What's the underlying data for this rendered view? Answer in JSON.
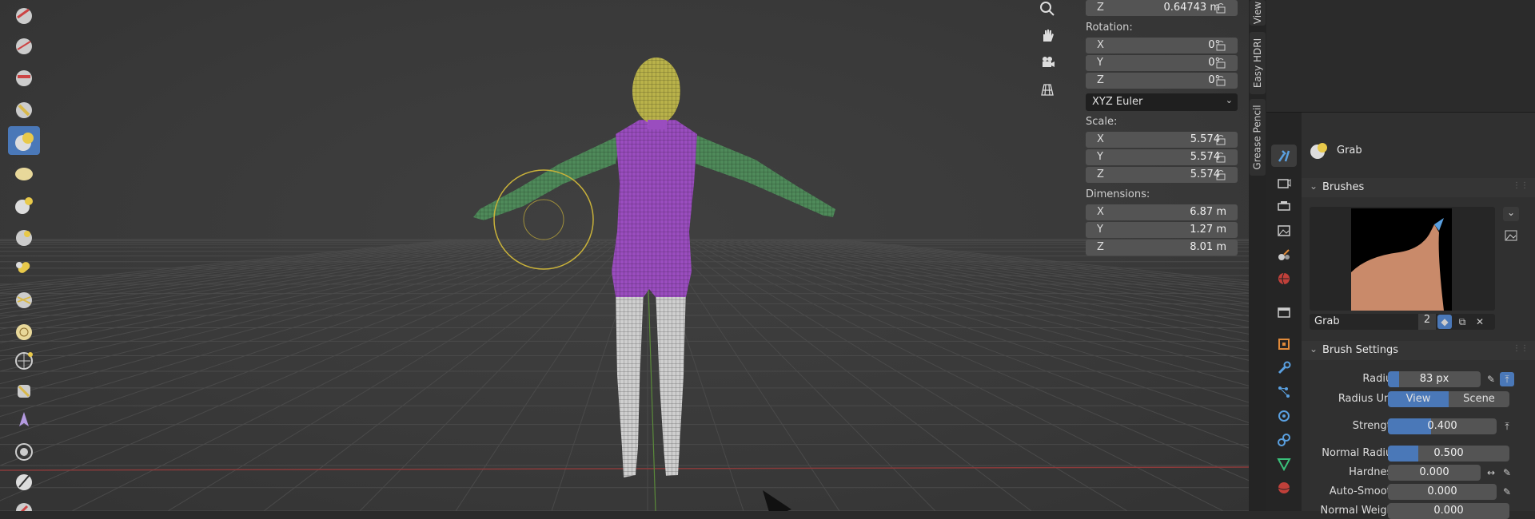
{
  "transform": {
    "location_z": {
      "axis": "Z",
      "value": "0.64743 m"
    },
    "rotation_label": "Rotation:",
    "rotation": [
      {
        "axis": "X",
        "value": "0°"
      },
      {
        "axis": "Y",
        "value": "0°"
      },
      {
        "axis": "Z",
        "value": "0°"
      }
    ],
    "rotation_mode": "XYZ Euler",
    "scale_label": "Scale:",
    "scale": [
      {
        "axis": "X",
        "value": "5.574"
      },
      {
        "axis": "Y",
        "value": "5.574"
      },
      {
        "axis": "Z",
        "value": "5.574"
      }
    ],
    "dimensions_label": "Dimensions:",
    "dimensions": [
      {
        "axis": "X",
        "value": "6.87 m"
      },
      {
        "axis": "Y",
        "value": "1.27 m"
      },
      {
        "axis": "Z",
        "value": "8.01 m"
      }
    ]
  },
  "side_tabs": [
    "View",
    "Easy HDRI",
    "Grease Pencil"
  ],
  "properties": {
    "tool_name": "Grab",
    "brushes_header": "Brushes",
    "brush_name": "Grab",
    "brush_users": "2",
    "brush_settings_header": "Brush Settings",
    "radius": {
      "label": "Radius",
      "value": "83 px"
    },
    "radius_unit": {
      "label": "Radius Unit",
      "options": [
        "View",
        "Scene"
      ],
      "selected": "View"
    },
    "strength": {
      "label": "Strength",
      "value": "0.400",
      "fill": 0.4
    },
    "normal_radius": {
      "label": "Normal Radius",
      "value": "0.500",
      "fill": 0.25
    },
    "hardness": {
      "label": "Hardness",
      "value": "0.000"
    },
    "auto_smooth": {
      "label": "Auto-Smooth",
      "value": "0.000"
    },
    "normal_weight": {
      "label": "Normal Weight",
      "value": "0.000"
    }
  },
  "colors": {
    "accent": "#4a78b8",
    "head": "#b9b24a",
    "torso": "#9a4dbf",
    "arms": "#4f8a5a",
    "legs": "#cfcfcf",
    "brush_circle": "#c8b13a"
  }
}
